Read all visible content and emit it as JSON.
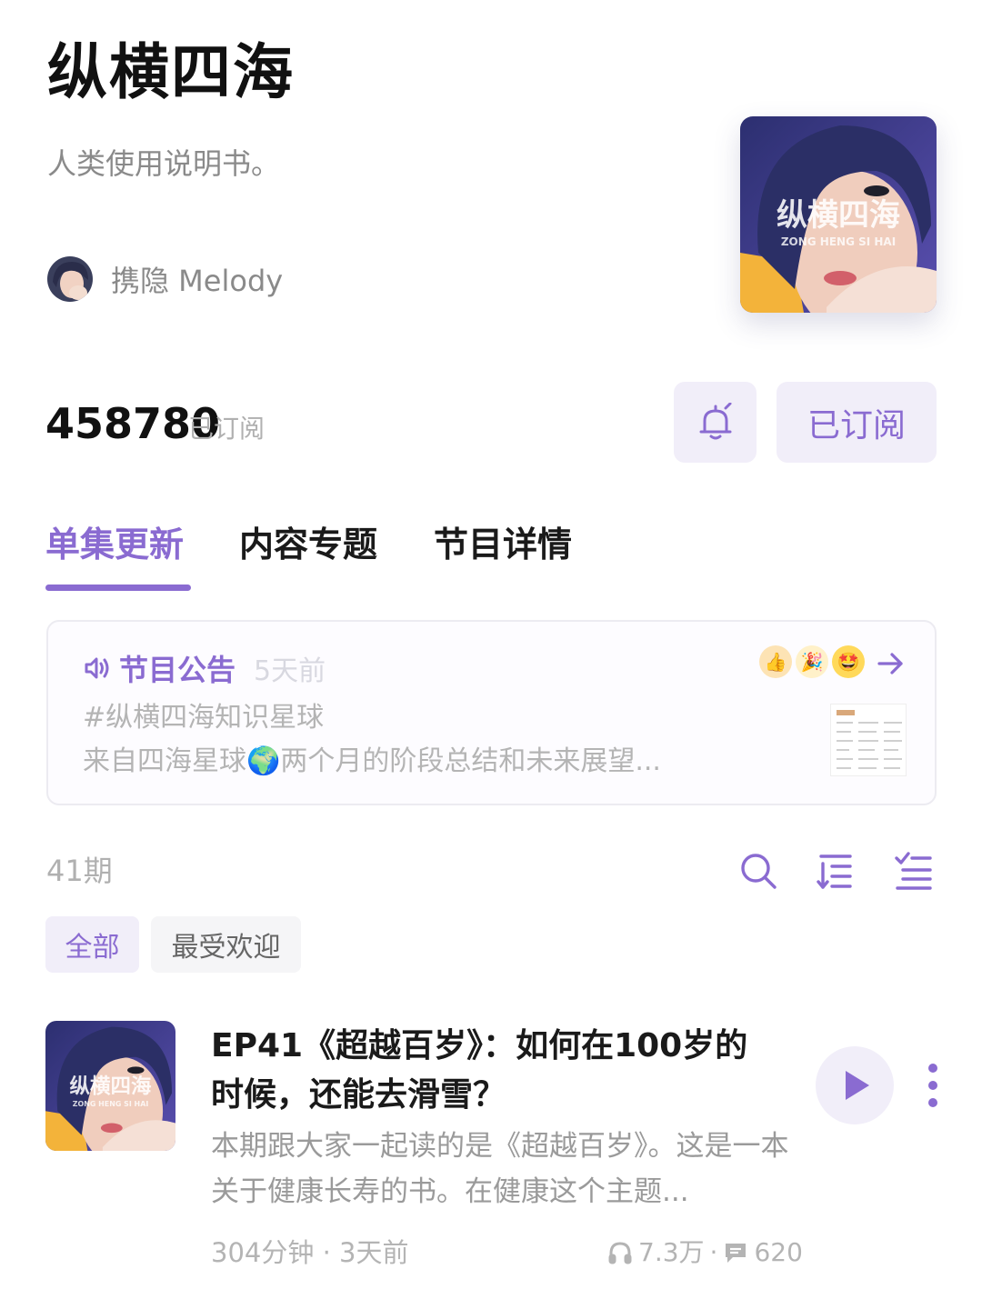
{
  "podcast": {
    "title": "纵横四海",
    "subtitle": "人类使用说明书。",
    "author": "携隐 Melody",
    "cover_text": "纵横四海",
    "cover_subtext": "ZONG HENG SI HAI"
  },
  "subscription": {
    "count": "458780",
    "count_label": "已订阅",
    "notify_icon": "bell-icon",
    "subscribed_label": "已订阅"
  },
  "tabs": [
    {
      "label": "单集更新",
      "active": true
    },
    {
      "label": "内容专题",
      "active": false
    },
    {
      "label": "节目详情",
      "active": false
    }
  ],
  "announcement": {
    "icon": "speaker-icon",
    "title": "节目公告",
    "time": "5天前",
    "line1": "#纵横四海知识星球",
    "line2": "来自四海星球🌍两个月的阶段总结和未来展望...",
    "emojis": [
      "👍",
      "🎉",
      "🤩"
    ]
  },
  "episodes_header": {
    "count": "41期",
    "tools": [
      "search-icon",
      "sort-icon",
      "filter-list-icon"
    ]
  },
  "filters": [
    {
      "label": "全部",
      "active": true
    },
    {
      "label": "最受欢迎",
      "active": false
    }
  ],
  "episode": {
    "title": "EP41《超越百岁》：如何在100岁的时候，还能去滑雪？",
    "description": "本期跟大家一起读的是《超越百岁》。这是一本关于健康长寿的书。在健康这个主题...",
    "duration_time": "304分钟 · 3天前",
    "plays": "7.3万",
    "separator": "·",
    "comments": "620"
  },
  "colors": {
    "accent": "#8a6bd1",
    "accent_bg": "#f1eef9"
  }
}
